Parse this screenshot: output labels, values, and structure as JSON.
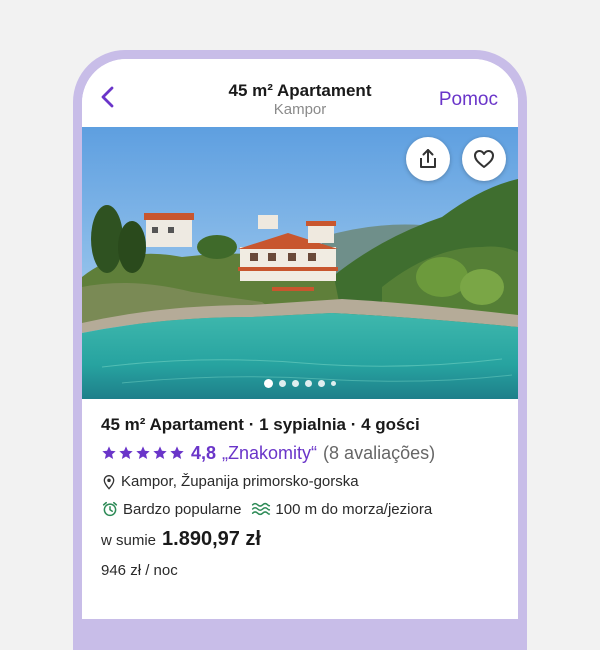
{
  "header": {
    "title": "45 m² Apartament",
    "subtitle": "Kampor",
    "help_label": "Pomoc"
  },
  "gallery": {
    "photo_count": 6,
    "current_index": 1
  },
  "listing": {
    "title": "45 m² Apartament · 1 sypialnia · 4 gości",
    "stars": 5,
    "rating_value": "4,8",
    "rating_word": "„Znakomity“",
    "review_count": "(8 avaliações)",
    "location": "Kampor, Županija primorsko-gorska",
    "feature_popular": "Bardzo popularne",
    "feature_distance": "100 m do morza/jeziora",
    "price_label": "w sumie",
    "price_total": "1.890,97 zł",
    "price_per_night": "946 zł  / noc"
  },
  "icons": {
    "back": "chevron-left-icon",
    "share": "share-icon",
    "favorite": "heart-icon",
    "star": "star-icon",
    "location": "map-pin-icon",
    "popular": "alarm-clock-icon",
    "distance": "waves-icon"
  },
  "colors": {
    "accent": "#6a35c9",
    "frame": "#c8bde8",
    "popular_icon": "#2e8b57",
    "water_icon": "#2e8b57"
  }
}
